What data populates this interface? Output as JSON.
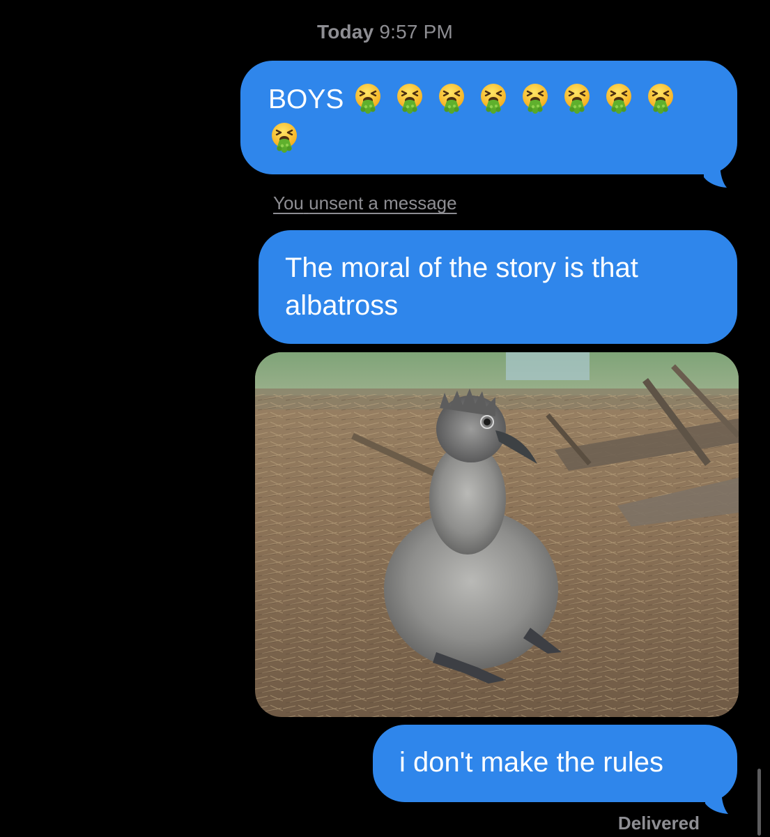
{
  "header": {
    "day": "Today",
    "time": "9:57 PM"
  },
  "messages": [
    {
      "id": "msg1",
      "text": "BOYS",
      "emoji_name": "face-vomiting-emoji",
      "emoji_count": 9
    },
    {
      "id": "unsent",
      "actor": "You",
      "text": "unsent a message"
    },
    {
      "id": "msg2",
      "text": "The moral of the story is that albatross"
    },
    {
      "id": "msg3",
      "type": "photo",
      "subject": "albatross-chick-photo"
    },
    {
      "id": "msg4",
      "text": "i don't make the rules"
    }
  ],
  "status": {
    "delivered": "Delivered"
  },
  "colors": {
    "background": "#000000",
    "bubble_blue": "#2f86eb",
    "meta_gray": "#8e8e93"
  }
}
